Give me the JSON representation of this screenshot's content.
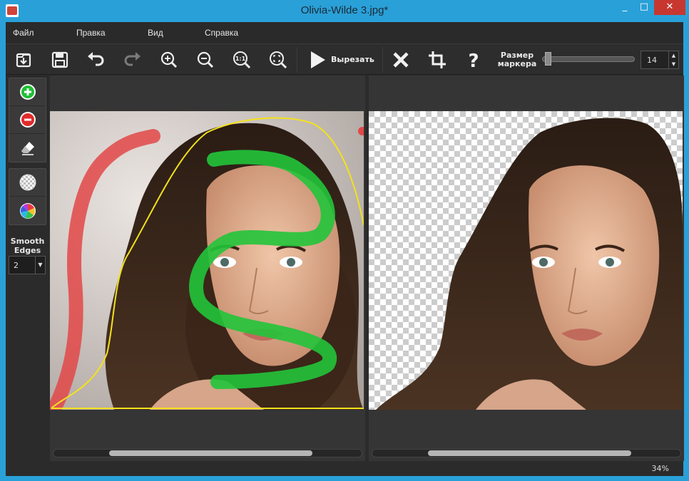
{
  "window": {
    "title": "Olivia-Wilde 3.jpg*"
  },
  "window_controls": {
    "minimize": "_",
    "maximize": "□",
    "close": "✕"
  },
  "menu": {
    "items": [
      "Файл",
      "Правка",
      "Вид",
      "Справка"
    ]
  },
  "toolbar": {
    "cut_label": "Вырезать",
    "brush_size_label": "Размер маркера",
    "brush_size_value": "14",
    "brush_size_level": 0.03,
    "icons": [
      "open-icon",
      "save-icon",
      "undo-icon",
      "redo-icon",
      "zoom-in-icon",
      "zoom-out-icon",
      "zoom-actual-icon",
      "zoom-fit-icon",
      "play-icon",
      "close-icon",
      "crop-icon",
      "help-icon"
    ]
  },
  "tools": {
    "icons": [
      "add-marker-icon",
      "remove-marker-icon",
      "eraser-icon",
      "transparent-bg-icon",
      "color-bg-icon"
    ],
    "smooth_edges_label": "Smooth Edges",
    "smooth_edges_value": "2"
  },
  "status": {
    "zoom": "34%"
  },
  "colors": {
    "keep_marker": "#22c43a",
    "remove_marker": "#e04848",
    "selection_outline": "#f4e21a",
    "title_bar": "#2aa0d8",
    "close_button": "#c7372f"
  },
  "scrollbars": {
    "left_position": 0.18,
    "left_visible": 0.66,
    "right_position": 0.18,
    "right_visible": 0.66
  }
}
